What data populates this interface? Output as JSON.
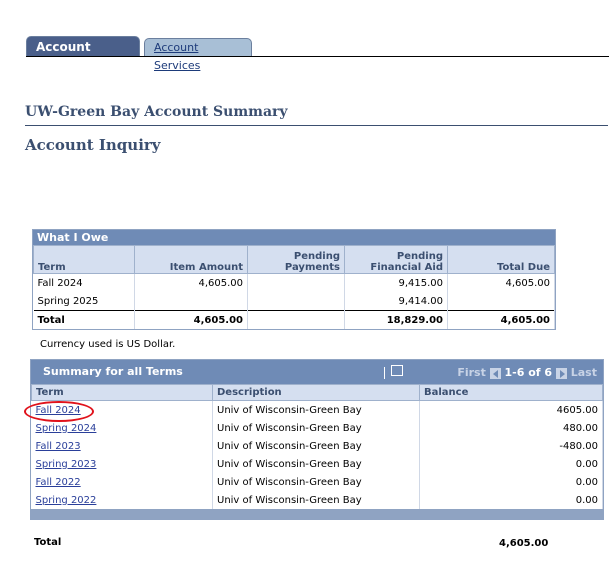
{
  "tabs": [
    {
      "label": "Account Inquiry",
      "active": true
    },
    {
      "label": "Account Services",
      "active": false
    }
  ],
  "org_title": "UW-Green Bay Account Summary",
  "page_title": "Account Inquiry",
  "what_i_owe": {
    "title": "What I Owe",
    "headers": [
      "Term",
      "Item Amount",
      "Pending Payments",
      "Pending Financial Aid",
      "Total Due"
    ],
    "rows": [
      {
        "term": "Fall 2024",
        "item_amount": "4,605.00",
        "pending_payments": "",
        "pending_aid": "9,415.00",
        "total_due": "4,605.00"
      },
      {
        "term": "Spring 2025",
        "item_amount": "",
        "pending_payments": "",
        "pending_aid": "9,414.00",
        "total_due": ""
      }
    ],
    "total": {
      "label": "Total",
      "item_amount": "4,605.00",
      "pending_payments": "",
      "pending_aid": "18,829.00",
      "total_due": "4,605.00"
    }
  },
  "currency_note": "Currency used is US Dollar.",
  "summary": {
    "title": "Summary for all Terms",
    "nav": {
      "first": "First",
      "range": "1-6 of 6",
      "last": "Last"
    },
    "headers": [
      "Term",
      "Description",
      "Balance"
    ],
    "rows": [
      {
        "term": "Fall 2024",
        "description": "Univ of Wisconsin-Green Bay",
        "balance": "4605.00"
      },
      {
        "term": "Spring 2024",
        "description": "Univ of Wisconsin-Green Bay",
        "balance": "480.00"
      },
      {
        "term": "Fall 2023",
        "description": "Univ of Wisconsin-Green Bay",
        "balance": "-480.00"
      },
      {
        "term": "Spring 2023",
        "description": "Univ of Wisconsin-Green Bay",
        "balance": "0.00"
      },
      {
        "term": "Fall 2022",
        "description": "Univ of Wisconsin-Green Bay",
        "balance": "0.00"
      },
      {
        "term": "Spring 2022",
        "description": "Univ of Wisconsin-Green Bay",
        "balance": "0.00"
      }
    ]
  },
  "grand_total": {
    "label": "Total",
    "value": "4,605.00"
  },
  "colors": {
    "accent": "#6f8bb6",
    "highlight_circle": "#e0121b",
    "link": "#2a3f9a"
  }
}
